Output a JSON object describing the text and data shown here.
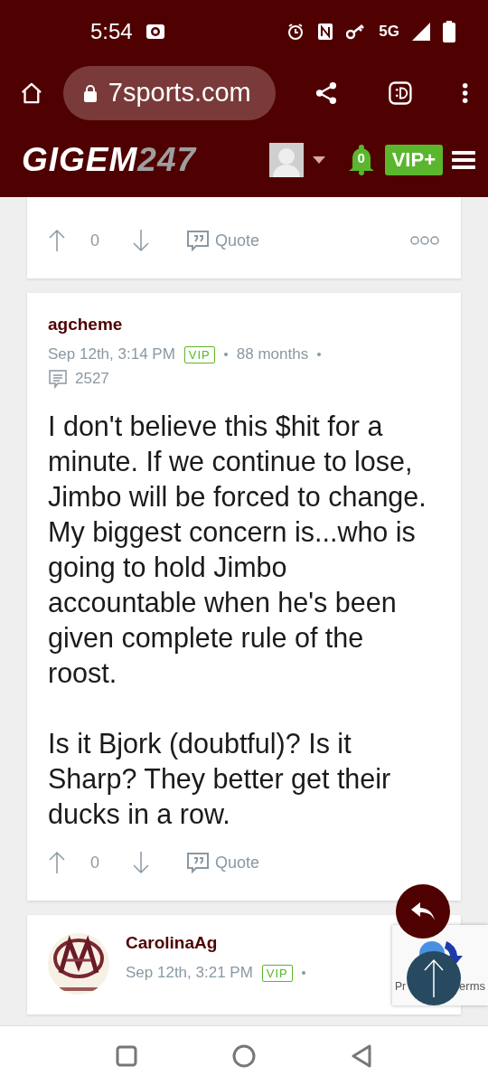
{
  "status_bar": {
    "time": "5:54",
    "network": "5G"
  },
  "browser": {
    "url": "7sports.com"
  },
  "site_header": {
    "logo": "GIGEM",
    "logo_suffix": "247",
    "notifications": "0",
    "vip_button": "VIP+"
  },
  "posts": [
    {
      "kind": "footer",
      "votes": "0",
      "quote": "Quote"
    },
    {
      "kind": "full",
      "author": "agcheme",
      "time": "Sep 12th, 3:14 PM",
      "badge": "VIP",
      "tenure": "88 months",
      "post_count": "2527",
      "paragraphs": [
        "I don't believe this $hit for a minute. If we continue to lose, Jimbo will be forced to change. My biggest concern is...who is going to hold Jimbo accountable when he's been given complete rule of the roost.",
        "Is it Bjork (doubtful)? Is it Sharp? They better get their ducks in a row."
      ],
      "votes": "0",
      "quote": "Quote"
    },
    {
      "kind": "header",
      "author": "CarolinaAg",
      "time": "Sep 12th, 3:21 PM",
      "badge": "VIP"
    }
  ],
  "recaptcha": {
    "texts": [
      "Pr",
      "erms"
    ]
  }
}
